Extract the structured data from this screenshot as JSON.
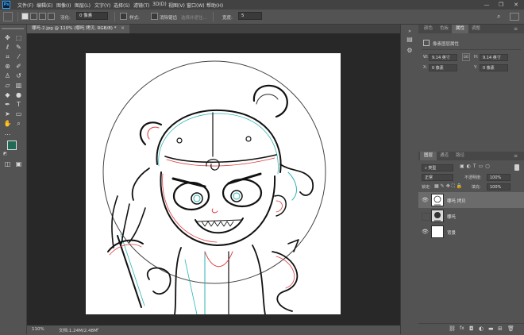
{
  "menubar": {
    "logo": "Ps",
    "items": [
      "文件(F)",
      "编辑(E)",
      "图像(I)",
      "图层(L)",
      "文字(Y)",
      "选择(S)",
      "滤镜(T)",
      "3D(D)",
      "视图(V)",
      "窗口(W)",
      "帮助(H)"
    ],
    "minimize": "—",
    "restore": "❐",
    "close": "✕"
  },
  "options": {
    "feather_label": "羽化:",
    "feather_value": "0 像素",
    "style_label": "样式:",
    "style_value": "正常",
    "antialias": "消除锯齿",
    "select_mask": "选择并遮住...",
    "width_label": "宽度:",
    "width_value": "5"
  },
  "document": {
    "tab_title": "哪吒-2.jpg @ 110% (哪吒 拷贝, RGB/8) *",
    "close": "✕",
    "zoom": "110%",
    "doc_info": "文档:1.24M/2.48M"
  },
  "colors": {
    "foreground": "#1f6b55",
    "background": "#ffffff",
    "accent": "#31a8ff"
  },
  "top_panel": {
    "tabs": [
      "颜色",
      "色板",
      "属性",
      "调整"
    ],
    "active_tab": "属性",
    "title": "像素图层属性",
    "w_label": "W:",
    "w_value": "9.14 英寸",
    "h_label": "H:",
    "h_value": "9.14 英寸",
    "link": "GO",
    "x_label": "X:",
    "x_value": "0 像素",
    "y_label": "Y:",
    "y_value": "0 像素"
  },
  "layers_panel": {
    "tabs": [
      "图层",
      "通道",
      "路径"
    ],
    "filter_kind": "类型",
    "blend_mode": "正常",
    "opacity_label": "不透明度:",
    "opacity_value": "100%",
    "lock_label": "锁定:",
    "fill_label": "填充:",
    "fill_value": "100%",
    "layers": [
      {
        "name": "哪吒 拷贝",
        "visible": true,
        "selected": true
      },
      {
        "name": "哪吒",
        "visible": false,
        "selected": false
      },
      {
        "name": "背景",
        "visible": true,
        "selected": false
      }
    ],
    "footer_icons": [
      "link-icon",
      "fx-icon",
      "mask-icon",
      "adjustment-icon",
      "group-icon",
      "new-layer-icon",
      "trash-icon"
    ]
  }
}
